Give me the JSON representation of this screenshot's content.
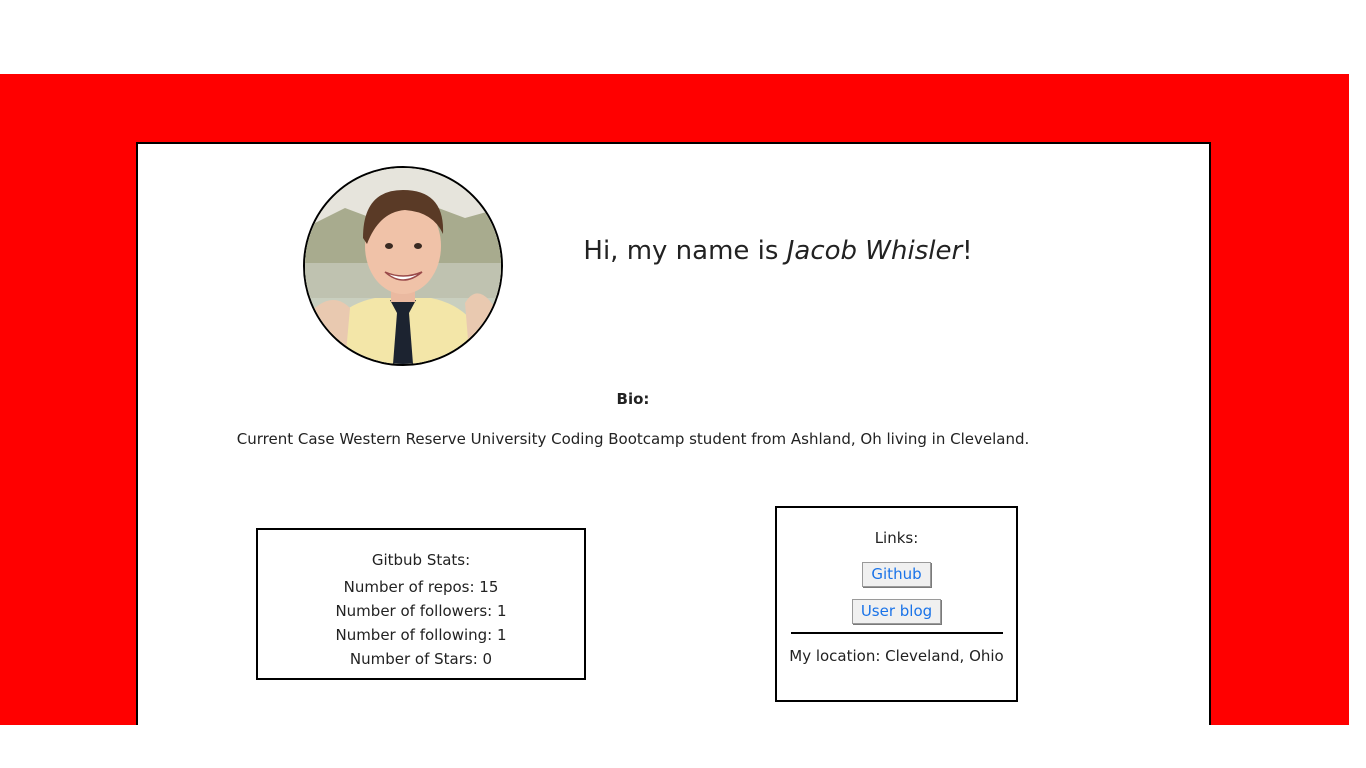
{
  "colors": {
    "background": "#ff0000",
    "card": "#ffffff",
    "border": "#000000",
    "link": "#1a73e8"
  },
  "profile": {
    "greeting_prefix": "Hi, my name is ",
    "name": "Jacob Whisler",
    "greeting_suffix": "!",
    "avatar_icon": "profile-photo"
  },
  "bio": {
    "title": "Bio:",
    "text": "Current Case Western Reserve University Coding Bootcamp student from Ashland, Oh living in Cleveland."
  },
  "stats": {
    "title": "Gitbub Stats:",
    "repos": "Number of repos: 15",
    "followers": "Number of followers: 1",
    "following": "Number of following: 1",
    "stars": "Number of Stars: 0"
  },
  "links": {
    "title": "Links:",
    "github_label": "Github",
    "blog_label": "User blog",
    "location": "My location: Cleveland, Ohio"
  }
}
